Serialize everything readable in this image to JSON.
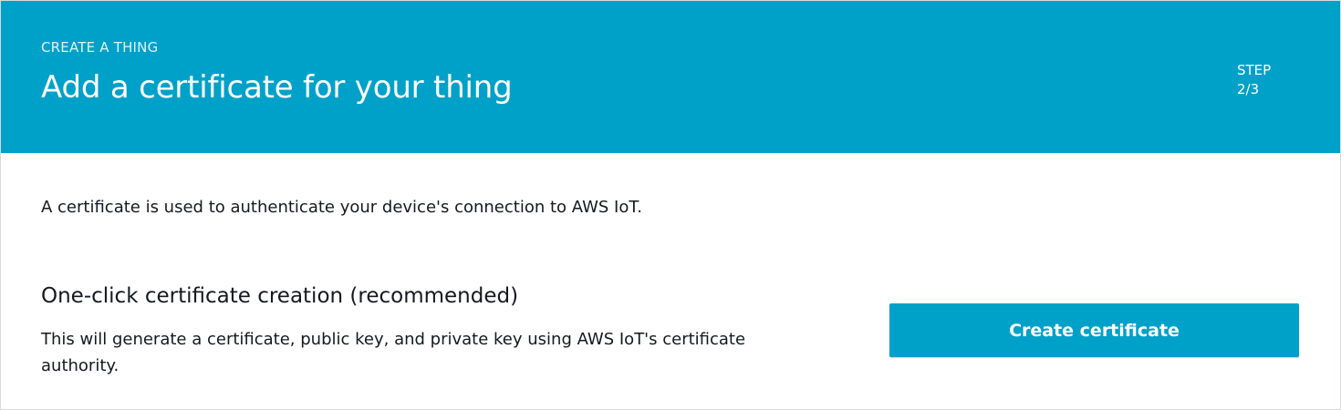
{
  "header": {
    "eyebrow": "CREATE A THING",
    "title": "Add a certificate for your thing",
    "step_label": "STEP",
    "step_value": "2/3",
    "background_color": "#00a1c9"
  },
  "main": {
    "intro": "A certificate is used to authenticate your device's connection to AWS IoT.",
    "one_click": {
      "title": "One-click certificate creation (recommended)",
      "description": "This will generate a certificate, public key, and private key using AWS IoT's certificate authority.",
      "button_label": "Create certificate"
    }
  }
}
